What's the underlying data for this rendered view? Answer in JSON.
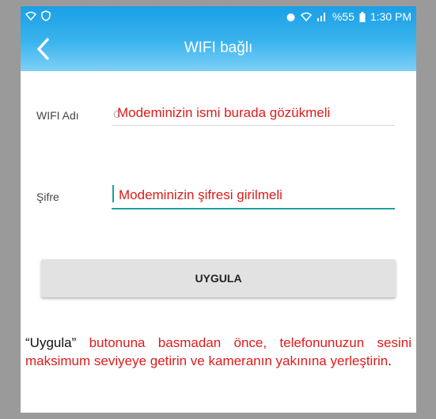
{
  "status_bar": {
    "battery_percent": "%55",
    "time": "1:30 PM",
    "left_icons": [
      "wifi-icon",
      "shield-icon"
    ],
    "right_icons": [
      "alarm-icon",
      "wifi-icon",
      "signal-icon",
      "battery-icon"
    ]
  },
  "header": {
    "title": "WIFI bağlı",
    "back_icon": "chevron-left-icon"
  },
  "form": {
    "wifi_name_label": "WIFI Adı",
    "wifi_name_value": "C",
    "wifi_name_annotation": "Modeminizin ismi burada gözükmeli",
    "password_label": "Şifre",
    "password_annotation": "Modeminizin şifresi girilmeli"
  },
  "apply_button": "UYGULA",
  "instructions": {
    "quoted": "“Uygula”",
    "text": " butonuna basmadan önce,  telefonunuzun sesini maksimum seviyeye getirin ve kameranın yakınına yerleştirin",
    "end": "."
  },
  "colors": {
    "header_top": "#1a9fe6",
    "header_bottom": "#7fd0f7",
    "accent_teal": "#1aa39a",
    "annotation_red": "#e01b1b",
    "frame_gray": "#9a9a9a"
  }
}
